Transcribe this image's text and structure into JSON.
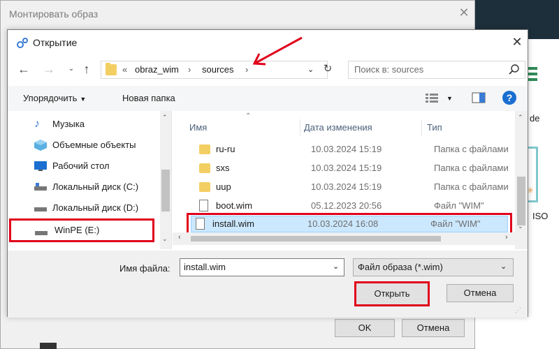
{
  "background": {
    "right_text_1": "de",
    "right_text_2": "ISO"
  },
  "outer_dialog": {
    "title": "Монтировать образ",
    "ok_label": "OK",
    "cancel_label": "Отмена"
  },
  "open_dialog": {
    "title": "Открытие",
    "address": {
      "prefix": "«",
      "crumbs": [
        "obraz_wim",
        "sources"
      ],
      "separator": "›"
    },
    "search_placeholder": "Поиск в: sources",
    "toolbar": {
      "organize_label": "Упорядочить",
      "new_folder_label": "Новая папка"
    },
    "nav_tree": [
      {
        "label": "Музыка",
        "icon": "music-icon"
      },
      {
        "label": "Объемные объекты",
        "icon": "3d-objects-icon"
      },
      {
        "label": "Рабочий стол",
        "icon": "desktop-icon"
      },
      {
        "label": "Локальный диск (C:)",
        "icon": "drive-icon"
      },
      {
        "label": "Локальный диск (D:)",
        "icon": "drive-icon"
      },
      {
        "label": "WinPE (E:)",
        "icon": "drive-icon",
        "highlighted": true
      }
    ],
    "columns": {
      "name": "Имя",
      "date": "Дата изменения",
      "type": "Тип"
    },
    "files": [
      {
        "name": "ru-ru",
        "date": "10.03.2024 15:19",
        "type": "Папка с файлами",
        "kind": "folder"
      },
      {
        "name": "sxs",
        "date": "10.03.2024 15:19",
        "type": "Папка с файлами",
        "kind": "folder"
      },
      {
        "name": "uup",
        "date": "10.03.2024 15:19",
        "type": "Папка с файлами",
        "kind": "folder"
      },
      {
        "name": "boot.wim",
        "date": "05.12.2023 20:56",
        "type": "Файл \"WIM\"",
        "kind": "file"
      },
      {
        "name": "install.wim",
        "date": "10.03.2024 16:08",
        "type": "Файл \"WIM\"",
        "kind": "file",
        "selected": true
      }
    ],
    "filename_label": "Имя файла:",
    "filename_value": "install.wim",
    "filetype_value": "Файл образа (*.wim)",
    "open_label": "Открыть",
    "cancel_label": "Отмена"
  },
  "colors": {
    "highlight_red": "#e0001b",
    "selection_blue": "#cce8ff",
    "folder_yellow": "#f3cf63"
  }
}
